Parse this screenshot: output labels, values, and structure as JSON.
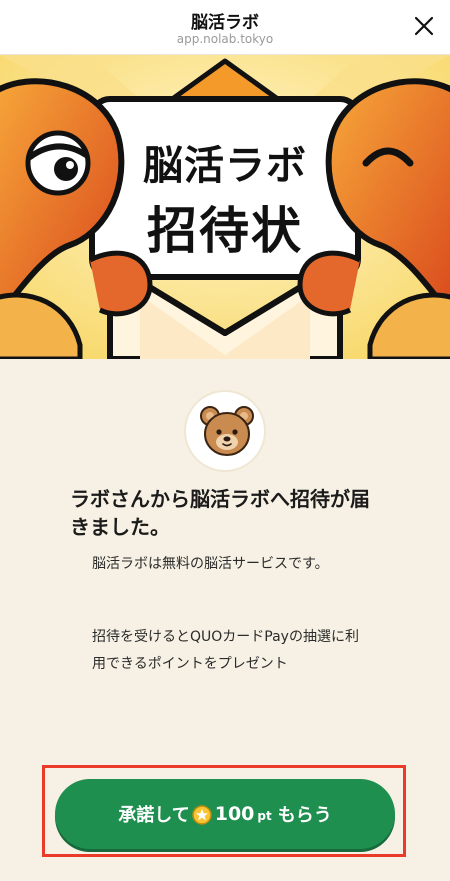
{
  "header": {
    "title": "脳活ラボ",
    "url": "app.nolab.tokyo"
  },
  "hero": {
    "title_line1": "脳活ラボ",
    "title_line2": "招待状"
  },
  "invite": {
    "headline": "ラボさんから脳活ラボへ招待が届きました。",
    "description_1": "脳活ラボは無料の脳活サービスです。",
    "description_2": "招待を受けるとQUOカードPayの抽選に利用できるポイントをプレゼント"
  },
  "cta": {
    "prefix": "承諾して",
    "points": "100",
    "unit": "pt",
    "suffix": "もらう"
  },
  "colors": {
    "accent_green": "#1e8f4f",
    "highlight_red": "#ea3b2a",
    "background": "#f6f1e4"
  },
  "icons": {
    "close": "close-icon",
    "avatar": "bear-avatar-icon",
    "coin": "star-coin-icon"
  }
}
